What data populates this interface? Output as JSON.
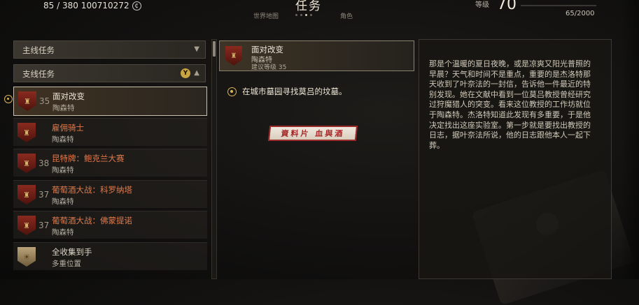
{
  "hud": {
    "stats": "85 / 380",
    "money": "100710272",
    "screen_title": "任务",
    "nav_left": "世界地图",
    "nav_right": "角色",
    "level_label": "等级",
    "level": "70",
    "xp": "65/2000"
  },
  "categories": {
    "main": "主线任务",
    "side": "支线任务",
    "side_badge": "Y"
  },
  "quests": [
    {
      "level": "35",
      "title": "面对改变",
      "giver": "陶森特",
      "selected": true,
      "tracked": true,
      "icon": "shield-crest-icon"
    },
    {
      "level": "",
      "title": "雇佣骑士",
      "giver": "陶森特",
      "icon": "shield-crest-icon"
    },
    {
      "level": "38",
      "title": "昆特牌：鲍克兰大赛",
      "giver": "陶森特",
      "icon": "shield-crest-icon"
    },
    {
      "level": "37",
      "title": "葡萄酒大战：科罗纳塔",
      "giver": "陶森特",
      "icon": "shield-crest-icon"
    },
    {
      "level": "37",
      "title": "葡萄酒大战：佛蒙提诺",
      "giver": "陶森特",
      "icon": "shield-crest-icon"
    },
    {
      "level": "",
      "title": "全收集到手",
      "giver": "多重位置",
      "icon": "sun-crest-icon"
    }
  ],
  "detail": {
    "title": "面对改变",
    "region": "陶森特",
    "suggested_level": "建议等级 35",
    "objective": "在城市墓园寻找莫吕的坟墓。",
    "stamp": "資料片 血與酒",
    "description": "那是个温暖的夏日夜晚，或是凉爽又阳光普照的早晨？天气和时间不是重点，重要的是杰洛特那天收到了叶奈法的一封信，告诉他一件最近的特别发现。她在文献中看到一位莫吕教授曾经研究过狩魔猎人的突变。看来这位教授的工作坊就位于陶森特。杰洛特知道此发现有多重要，于是他决定找出这座实验室。第一步就是要找出教授的日志，据叶奈法所说，他的日志跟他本人一起下葬。"
  }
}
